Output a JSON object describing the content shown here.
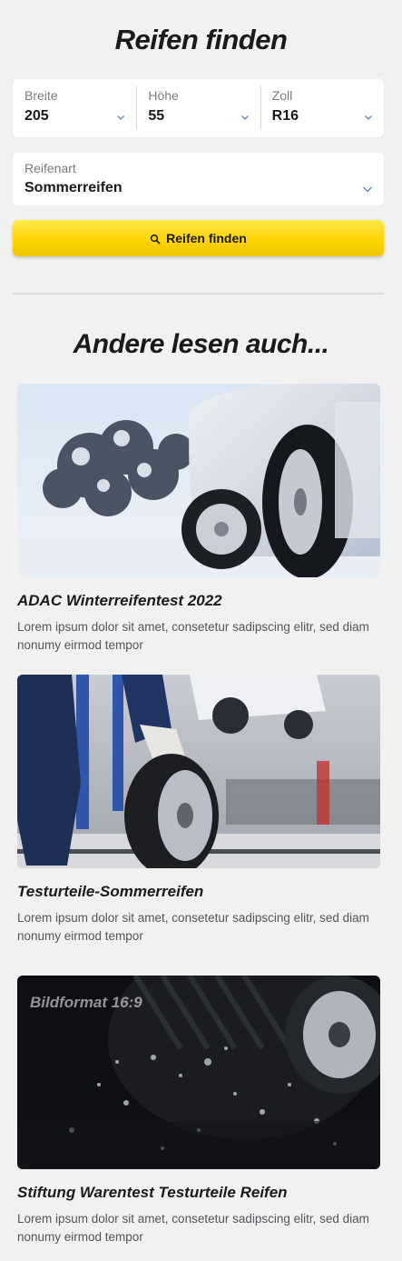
{
  "finder": {
    "title": "Reifen finden",
    "width": {
      "label": "Breite",
      "value": "205"
    },
    "height": {
      "label": "Höhe",
      "value": "55"
    },
    "rim": {
      "label": "Zoll",
      "value": "R16"
    },
    "type": {
      "label": "Reifenart",
      "value": "Sommerreifen"
    },
    "button_label": "Reifen finden"
  },
  "related": {
    "title": "Andere lesen auch...",
    "articles": [
      {
        "title": "ADAC Winterreifentest 2022",
        "text": "Lorem ipsum dolor sit amet, consetetur sadipscing elitr, sed diam nonumy eirmod tempor",
        "image": "winter-car-tire-snow"
      },
      {
        "title": "Testurteile-Sommerreifen",
        "text": "Lorem ipsum dolor sit amet, consetetur sadipscing elitr, sed diam nonumy eirmod tempor",
        "image": "mechanic-rolling-tire-workshop"
      },
      {
        "title": "Stiftung Warentest Testurteile Reifen",
        "text": "Lorem ipsum dolor sit amet, consetetur sadipscing elitr, sed diam nonumy eirmod tempor",
        "image": "tire-splashing-water",
        "overlay_text": "Bildformat 16:9"
      }
    ]
  },
  "colors": {
    "accent": "#ffd200",
    "background": "#f1f1f2",
    "chevron": "#6a86c4"
  }
}
